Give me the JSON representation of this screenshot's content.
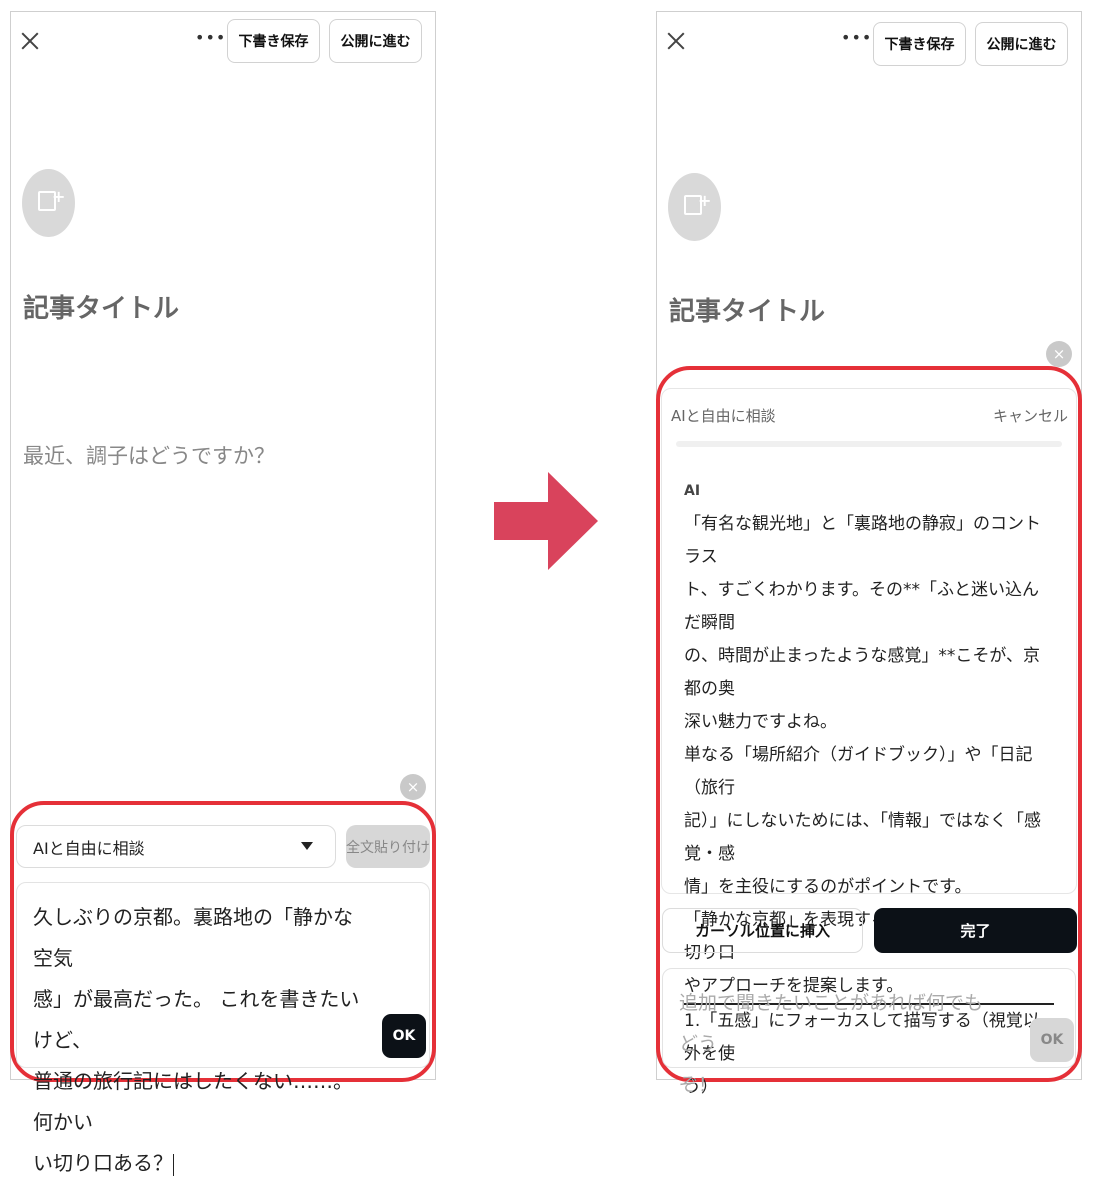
{
  "left_screen": {
    "header": {
      "more_label": "•••",
      "draft_label": "下書き保存",
      "publish_label": "公開に進む"
    },
    "editor": {
      "title_placeholder": "記事タイトル",
      "body_placeholder": "最近、調子はどうですか？"
    },
    "ai_panel": {
      "mode_label": "AIと自由に相談",
      "paste_label": "全文貼り付け",
      "input_lines": [
        "久しぶりの京都。裏路地の「静かな空気",
        "感」が最高だった。 これを書きたいけど、",
        "普通の旅行記にはしたくない……。 何かい",
        "い切り口ある？"
      ],
      "ok_label": "OK",
      "close_label": "×"
    }
  },
  "right_screen": {
    "header": {
      "more_label": "•••",
      "draft_label": "下書き保存",
      "publish_label": "公開に進む"
    },
    "editor": {
      "title_placeholder": "記事タイトル"
    },
    "ai_panel": {
      "close_label": "×",
      "mode_label": "AIと自由に相談",
      "cancel_label": "キャンセル",
      "ai_label": "AI",
      "response_lines": [
        "「有名な観光地」と「裏路地の静寂」のコントラス",
        "ト、すごくわかります。その**「ふと迷い込んだ瞬間",
        "の、時間が止まったような感覚」**こそが、京都の奥",
        "深い魅力ですよね。",
        "単なる「場所紹介（ガイドブック）」や「日記（旅行",
        "記）」にしないためには、「情報」ではなく「感覚・感",
        "情」を主役にするのがポイントです。",
        "「静かな京都」を表現するための、いくつかの切り口",
        "やアプローチを提案します。"
      ],
      "response_list_lines": [
        "1.「五感」にフォーカスして描写する（視覚以外を使",
        "う）"
      ],
      "insert_label": "カーソル位置に挿入",
      "done_label": "完了",
      "followup_placeholder_lines": [
        "追加で聞きたいことがあれば何でもどう",
        "ぞ！"
      ],
      "ok_label": "OK"
    }
  },
  "colors": {
    "highlight_frame": "#e53038",
    "arrow": "#d9435c",
    "primary_button": "#0c1117"
  }
}
